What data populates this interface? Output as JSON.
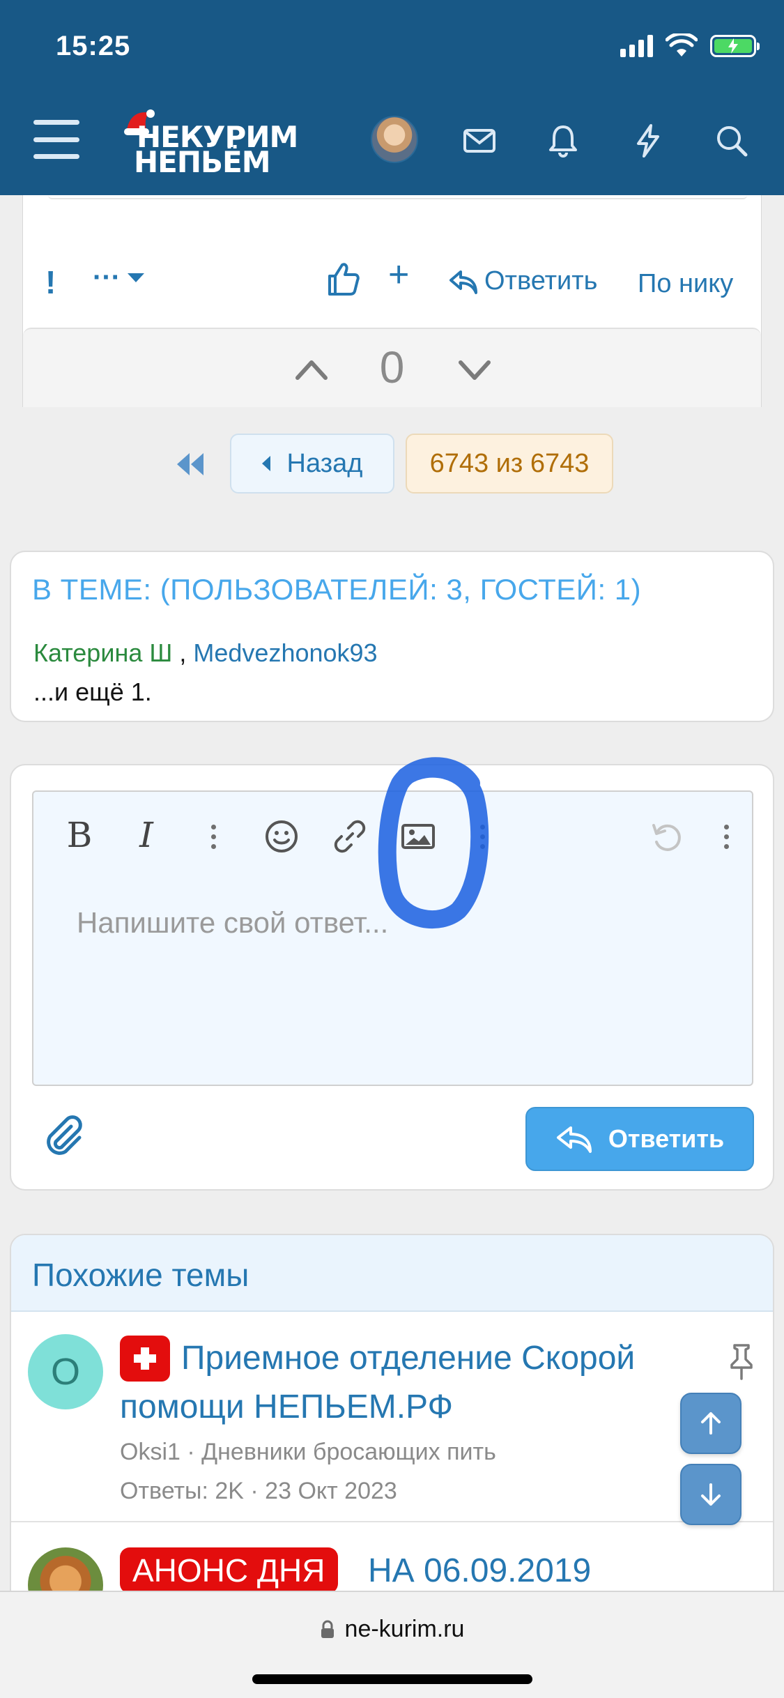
{
  "status_bar": {
    "time": "15:25"
  },
  "header": {
    "logo_line1": "НЕКУРИМ",
    "logo_line2": "НЕПЬЁМ",
    "icons": [
      "menu-icon",
      "avatar",
      "mail-icon",
      "bell-icon",
      "lightning-icon",
      "search-icon"
    ]
  },
  "post_actions": {
    "report": "!",
    "more": "···",
    "plus": "+",
    "reply": "Ответить",
    "by_nick": "По нику",
    "vote_count": "0"
  },
  "pagination": {
    "back": "Назад",
    "counter": "6743 из 6743"
  },
  "in_topic": {
    "title": "В ТЕМЕ: (ПОЛЬЗОВАТЕЛЕЙ: 3, ГОСТЕЙ: 1)",
    "user1": "Катерина Ш",
    "separator": ",",
    "user2": "Medvezhonok93",
    "more": "...и ещё 1."
  },
  "editor": {
    "bold": "B",
    "italic": "I",
    "placeholder": "Напишите свой ответ...",
    "reply_button": "Ответить"
  },
  "similar": {
    "heading": "Похожие темы",
    "items": [
      {
        "avatar_letter": "O",
        "title": "Приемное отделение Скорой помощи НЕПЬЕМ.РФ",
        "meta": "Oksi1 · Дневники бросающих пить",
        "stats": "Ответы: 2K · 23 Окт 2023"
      },
      {
        "badge": "АНОНС ДНЯ",
        "title": "НА 06.09.2019"
      }
    ]
  },
  "browser": {
    "url": "ne-kurim.ru"
  },
  "colors": {
    "header": "#185886",
    "link": "#2577b1",
    "accent": "#47a7eb",
    "badge_red": "#e30d0d",
    "user_green": "#2b8a3e"
  }
}
